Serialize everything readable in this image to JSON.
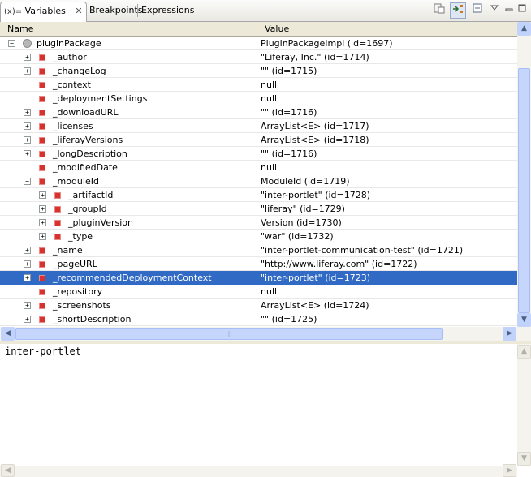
{
  "tabs": {
    "variables": {
      "icon": "(x)=",
      "label": "Variables",
      "close": "✕"
    },
    "breakpoints": {
      "label": "Breakpoints"
    },
    "expressions": {
      "label": "Expressions"
    }
  },
  "columns": {
    "name": "Name",
    "value": "Value"
  },
  "rows": [
    {
      "name": "pluginPackage",
      "value": "PluginPackageImpl  (id=1697)"
    },
    {
      "name": "_author",
      "value": "\"Liferay, Inc.\" (id=1714)"
    },
    {
      "name": "_changeLog",
      "value": "\"\" (id=1715)"
    },
    {
      "name": "_context",
      "value": "null"
    },
    {
      "name": "_deploymentSettings",
      "value": "null"
    },
    {
      "name": "_downloadURL",
      "value": "\"\" (id=1716)"
    },
    {
      "name": "_licenses",
      "value": "ArrayList<E>  (id=1717)"
    },
    {
      "name": "_liferayVersions",
      "value": "ArrayList<E>  (id=1718)"
    },
    {
      "name": "_longDescription",
      "value": "\"\" (id=1716)"
    },
    {
      "name": "_modifiedDate",
      "value": "null"
    },
    {
      "name": "_moduleId",
      "value": "ModuleId  (id=1719)"
    },
    {
      "name": "_artifactId",
      "value": "\"inter-portlet\" (id=1728)"
    },
    {
      "name": "_groupId",
      "value": "\"liferay\" (id=1729)"
    },
    {
      "name": "_pluginVersion",
      "value": "Version  (id=1730)"
    },
    {
      "name": "_type",
      "value": "\"war\" (id=1732)"
    },
    {
      "name": "_name",
      "value": "\"inter-portlet-communication-test\" (id=1721)"
    },
    {
      "name": "_pageURL",
      "value": "\"http://www.liferay.com\" (id=1722)"
    },
    {
      "name": "_recommendedDeploymentContext",
      "value": "\"inter-portlet\" (id=1723)"
    },
    {
      "name": "_repository",
      "value": "null"
    },
    {
      "name": "_screenshots",
      "value": "ArrayList<E>  (id=1724)"
    },
    {
      "name": "_shortDescription",
      "value": "\"\" (id=1725)"
    }
  ],
  "detail": {
    "text": "inter-portlet"
  },
  "scroll": {
    "up": "▲",
    "down": "▼",
    "left": "◀",
    "right": "▶",
    "grip": "|||"
  }
}
